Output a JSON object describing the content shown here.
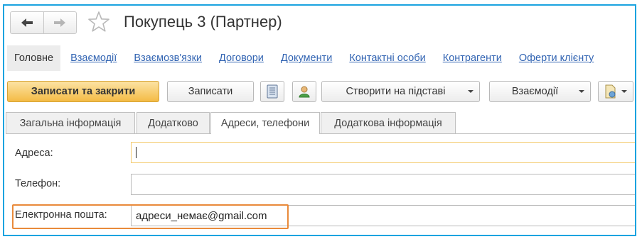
{
  "window": {
    "title": "Покупець 3 (Партнер)",
    "back_icon": "arrow-left-icon",
    "forward_icon": "arrow-right-icon",
    "favorite_icon": "star-icon"
  },
  "sections": [
    {
      "label": "Головне"
    },
    {
      "label": "Взаємодії"
    },
    {
      "label": "Взаємозв'язки"
    },
    {
      "label": "Договори"
    },
    {
      "label": "Документи"
    },
    {
      "label": "Контактні особи"
    },
    {
      "label": "Контрагенти"
    },
    {
      "label": "Оферти клієнту"
    }
  ],
  "toolbar": {
    "save_close_label": "Записати та закрити",
    "save_label": "Записати",
    "create_based_label": "Створити на підставі",
    "interactions_label": "Взаємодії"
  },
  "tabs": [
    {
      "label": "Загальна інформація"
    },
    {
      "label": "Додатково"
    },
    {
      "label": "Адреси, телефони"
    },
    {
      "label": "Додаткова інформація"
    }
  ],
  "form": {
    "address_label": "Адреса:",
    "address_value": "",
    "phone_label": "Телефон:",
    "phone_value": "",
    "email_label": "Електронна пошта:",
    "email_value": "адреси_немає@gmail.com"
  },
  "colors": {
    "frame_border": "#1aa3e0",
    "link": "#3365b3",
    "primary_button": "#f4bb45",
    "highlight_box": "#e98a3a"
  }
}
